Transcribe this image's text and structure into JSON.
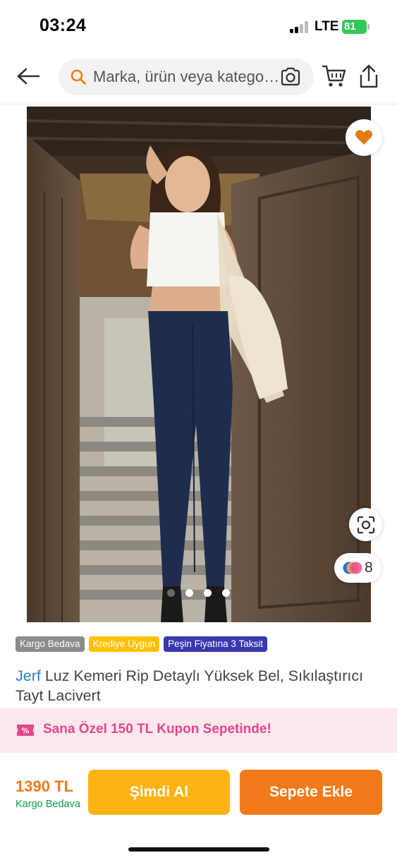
{
  "status_bar": {
    "time": "03:24",
    "network": "LTE",
    "battery": "81"
  },
  "header": {
    "back_icon": "arrow-left-icon",
    "search_placeholder": "Marka, ürün veya kategori ara",
    "search_icon": "search-icon",
    "camera_icon": "camera-search-icon",
    "cart_icon": "cart-icon",
    "share_icon": "share-icon"
  },
  "gallery": {
    "favorite_icon": "heart-icon",
    "lens_icon": "visual-search-icon",
    "variants_count": "8",
    "page_count": 4,
    "active_index": 0
  },
  "badges": [
    "Kargo Bedava",
    "Krediye Uygun",
    "Peşin Fiyatına 3 Taksit"
  ],
  "product": {
    "brand": "Jerf",
    "name": "Luz Kemeri Rip Detaylı Yüksek Bel, Sıkılaştırıcı Tayt Lacivert"
  },
  "coupon": {
    "icon": "coupon-icon",
    "text": "Sana Özel 150 TL Kupon Sepetinde!"
  },
  "purchase": {
    "price": "1390 TL",
    "shipping": "Kargo Bedava",
    "buy_now": "Şimdi Al",
    "add_to_cart": "Sepete Ekle"
  },
  "colors": {
    "orange": "#f27a1a",
    "yellow": "#fdb215",
    "brand_blue": "#2f7dcb",
    "coupon_pink": "#e8468a",
    "green": "#0f9c4b"
  }
}
